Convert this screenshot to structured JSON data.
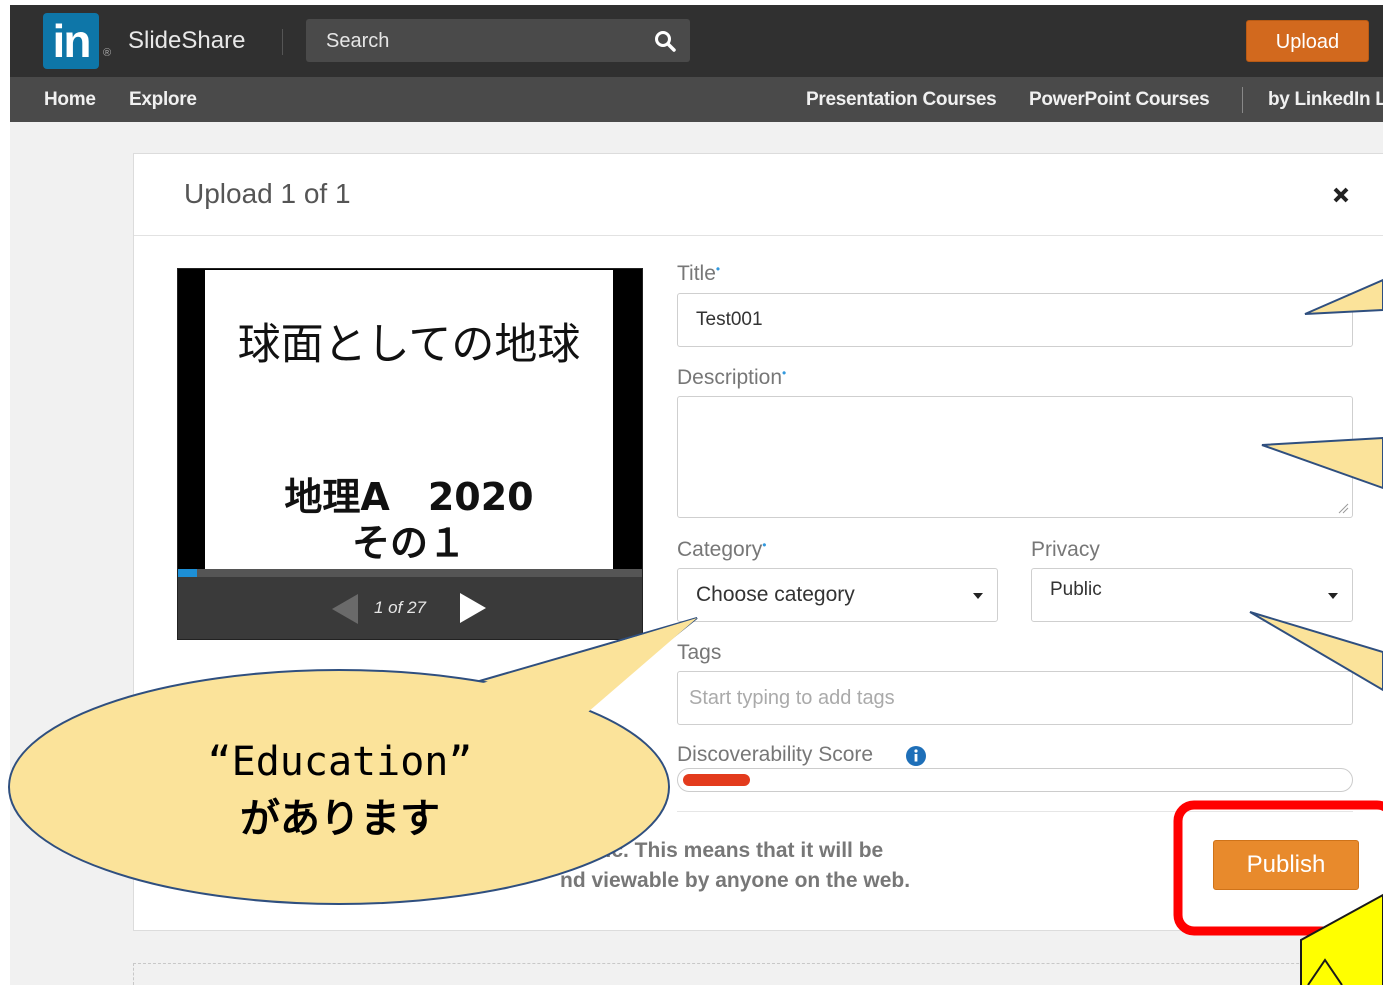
{
  "header": {
    "logo_text": "in",
    "brand": "SlideShare",
    "search_placeholder": "Search",
    "upload_label": "Upload"
  },
  "nav": {
    "left": [
      "Home",
      "Explore"
    ],
    "right": [
      "Presentation Courses",
      "PowerPoint Courses",
      "by LinkedIn L"
    ]
  },
  "dialog": {
    "title": "Upload 1 of 1",
    "close_icon": "close-icon"
  },
  "preview": {
    "slide_title": "球面としての地球",
    "slide_subtitle_1": "地理A　2020",
    "slide_subtitle_2": "その１",
    "page_counter": "1 of 27",
    "progress": 0.04
  },
  "form": {
    "title_label": "Title",
    "title_value": "Test001",
    "description_label": "Description",
    "description_value": "",
    "category_label": "Category",
    "category_value": "Choose category",
    "privacy_label": "Privacy",
    "privacy_value": "Public",
    "tags_label": "Tags",
    "tags_placeholder": "Start typing to add tags",
    "score_label": "Discoverability Score",
    "score_fraction": 0.1,
    "privacy_note_line1": "Public. This means that it will be",
    "privacy_note_line2": "nd viewable by anyone on the web.",
    "publish_label": "Publish"
  },
  "annotation": {
    "callout_line1": "“Education”",
    "callout_line2": "があります"
  },
  "colors": {
    "accent_orange": "#e88a2c",
    "linkedin_blue": "#0e76a8",
    "highlight_red": "#ff0000",
    "callout_fill": "#fbe39a",
    "arrow_yellow": "#ffff00"
  }
}
